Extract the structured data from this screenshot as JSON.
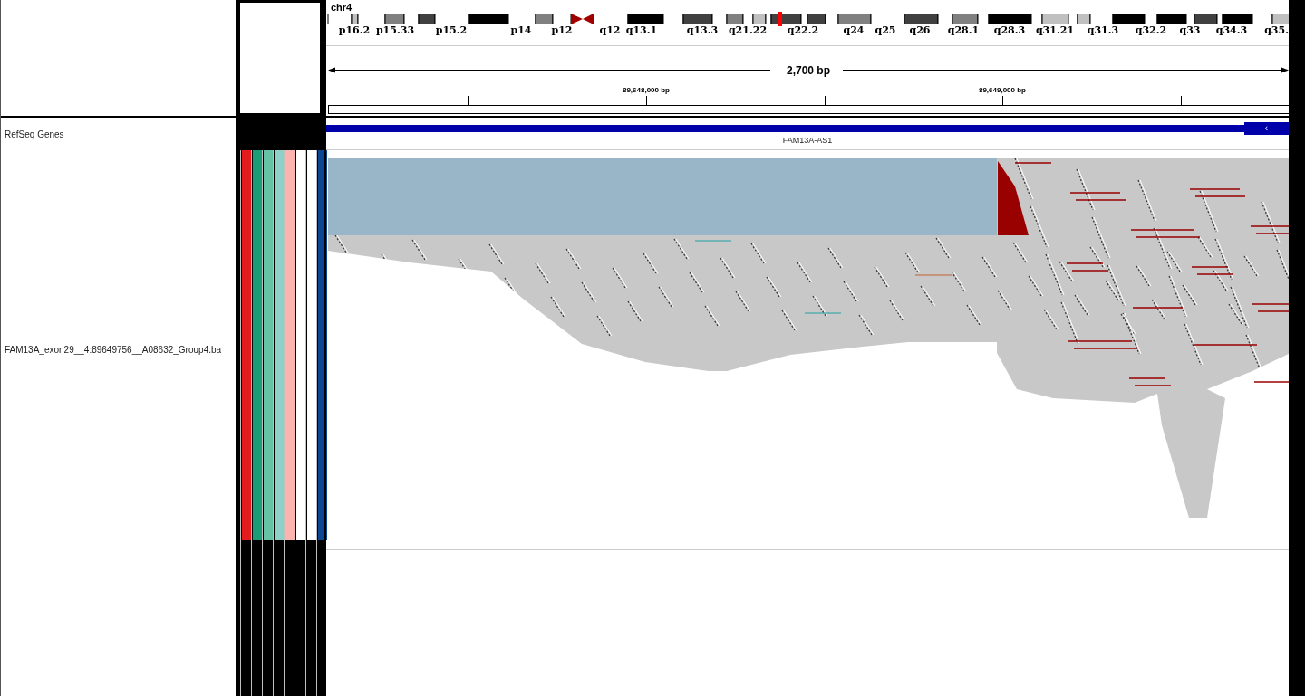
{
  "header": {
    "chromosome": "chr4",
    "cytobands": [
      {
        "label": "p16.2"
      },
      {
        "label": "p15.33"
      },
      {
        "label": "p15.2"
      },
      {
        "label": "p14"
      },
      {
        "label": "p12"
      },
      {
        "label": "q12"
      },
      {
        "label": "q13.1"
      },
      {
        "label": "q13.3"
      },
      {
        "label": "q21.22"
      },
      {
        "label": "q22.2"
      },
      {
        "label": "q24"
      },
      {
        "label": "q25"
      },
      {
        "label": "q26"
      },
      {
        "label": "q28.1"
      },
      {
        "label": "q28.3"
      },
      {
        "label": "q31.21"
      },
      {
        "label": "q31.3"
      },
      {
        "label": "q32.2"
      },
      {
        "label": "q33"
      },
      {
        "label": "q34.3"
      },
      {
        "label": "q35."
      }
    ],
    "ruler": {
      "span": "2,700 bp",
      "ticks": [
        "89,648,000 bp",
        "89,649,000 bp"
      ]
    }
  },
  "tracks": [
    {
      "kind": "feature",
      "name": "RefSeq Genes",
      "features": [
        {
          "label": "FAM13A-AS1",
          "arrow": "‹"
        }
      ]
    },
    {
      "kind": "alignment",
      "name": "FAM13A_exon29__4:89649756__A08632_Group4.ba",
      "attributes": [
        {
          "color": "#e41a1c"
        },
        {
          "color": "#1b9e77"
        },
        {
          "color": "#66c2a5"
        },
        {
          "color": "#8ed1c6"
        },
        {
          "color": "#fbb4ae"
        },
        {
          "color": "#ffffff"
        },
        {
          "color": "#ffffff"
        },
        {
          "color": "#0b4693"
        }
      ]
    }
  ]
}
